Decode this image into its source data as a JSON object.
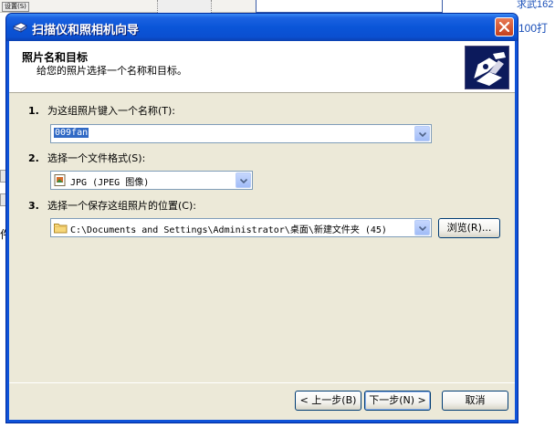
{
  "background": {
    "tab_label": "设置(S)",
    "right_text_top": "求武162",
    "right_text_mid": "100打",
    "left_label": "件"
  },
  "window": {
    "title": "扫描仪和照相机向导",
    "icons": {
      "title": "scanner-camera-icon",
      "close": "close-icon",
      "header": "wizard-camera-icon"
    }
  },
  "header": {
    "title": "照片名和目标",
    "subtitle": "给您的照片选择一个名称和目标。"
  },
  "steps": [
    {
      "number": "1.",
      "label": "为这组照片键入一个名称(T):"
    },
    {
      "number": "2.",
      "label": "选择一个文件格式(S):"
    },
    {
      "number": "3.",
      "label": "选择一个保存这组照片的位置(C):"
    }
  ],
  "fields": {
    "name_value": "009fan",
    "format_value": "JPG (JPEG 图像)",
    "location_value": "C:\\Documents and Settings\\Administrator\\桌面\\新建文件夹 (45)"
  },
  "buttons": {
    "browse": "浏览(R)...",
    "back": "< 上一步(B)",
    "next": "下一步(N) >",
    "cancel": "取消"
  },
  "colors": {
    "title_bar": "#0a55d8",
    "dialog_face": "#ece9d8",
    "selection": "#316ac5",
    "close_button": "#c4401e"
  }
}
